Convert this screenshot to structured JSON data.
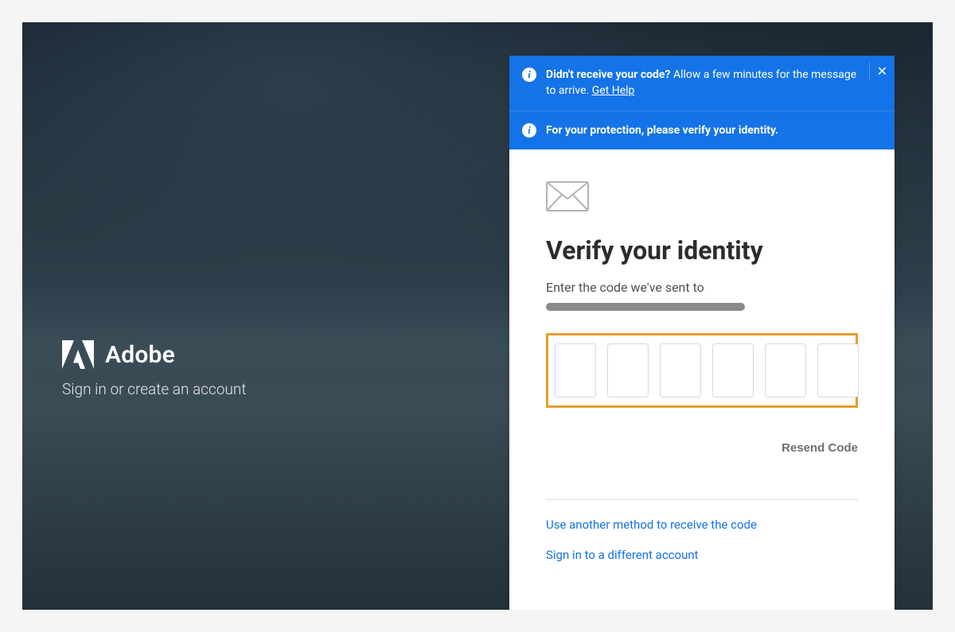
{
  "brand": {
    "name": "Adobe",
    "subtitle": "Sign in or create an account"
  },
  "banners": [
    {
      "bold": "Didn't receive your code?",
      "text": " Allow a few minutes for the message to arrive. ",
      "link": "Get Help",
      "closable": true
    },
    {
      "bold": "For your protection, please verify your identity.",
      "text": "",
      "link": "",
      "closable": false
    }
  ],
  "panel": {
    "title": "Verify your identity",
    "subtitle": "Enter the code we've sent to",
    "code_digits": 6,
    "resend_label": "Resend Code",
    "alt_method_link": "Use another method to receive the code",
    "different_account_link": "Sign in to a different account"
  }
}
